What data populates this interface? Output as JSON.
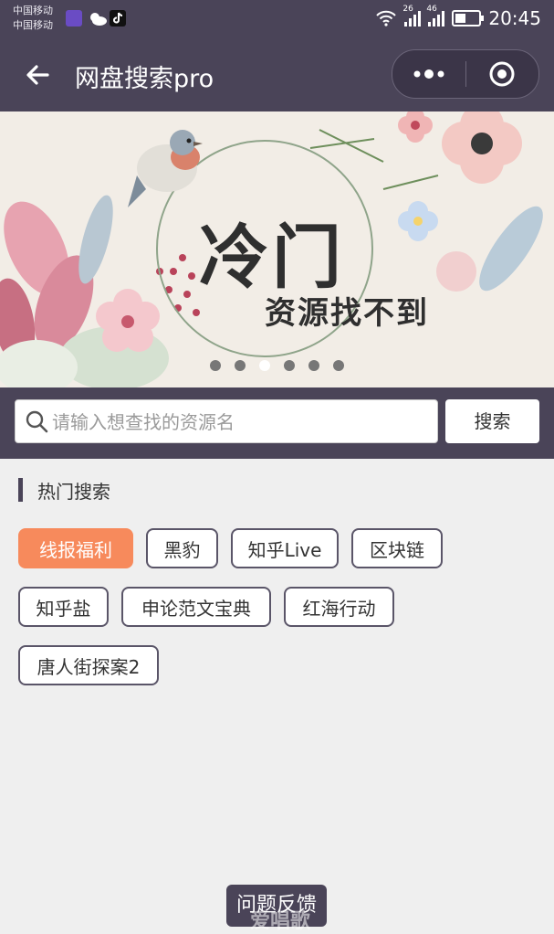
{
  "status_bar": {
    "carrier1": "中国移动",
    "carrier2": "中国移动",
    "net1": "26",
    "net2": "46",
    "time": "20:45"
  },
  "nav": {
    "title": "网盘搜索pro",
    "back_icon": "back-arrow-icon",
    "more_icon": "more-dots-icon",
    "close_icon": "target-close-icon"
  },
  "banner": {
    "headline": "冷门",
    "subline": "资源找不到",
    "dots_count": 6,
    "active_dot": 2
  },
  "search": {
    "placeholder": "请输入想查找的资源名",
    "button_label": "搜索"
  },
  "hot": {
    "title": "热门搜索",
    "tags": [
      "线报福利",
      "黑豹",
      "知乎Live",
      "区块链",
      "知乎盐",
      "申论范文宝典",
      "红海行动",
      "唐人街探案2"
    ]
  },
  "feedback": {
    "label": "问题反馈",
    "watermark": "爱唱歌"
  },
  "colors": {
    "theme": "#4a4458",
    "accent": "#f78a5c",
    "background": "#efefef"
  }
}
